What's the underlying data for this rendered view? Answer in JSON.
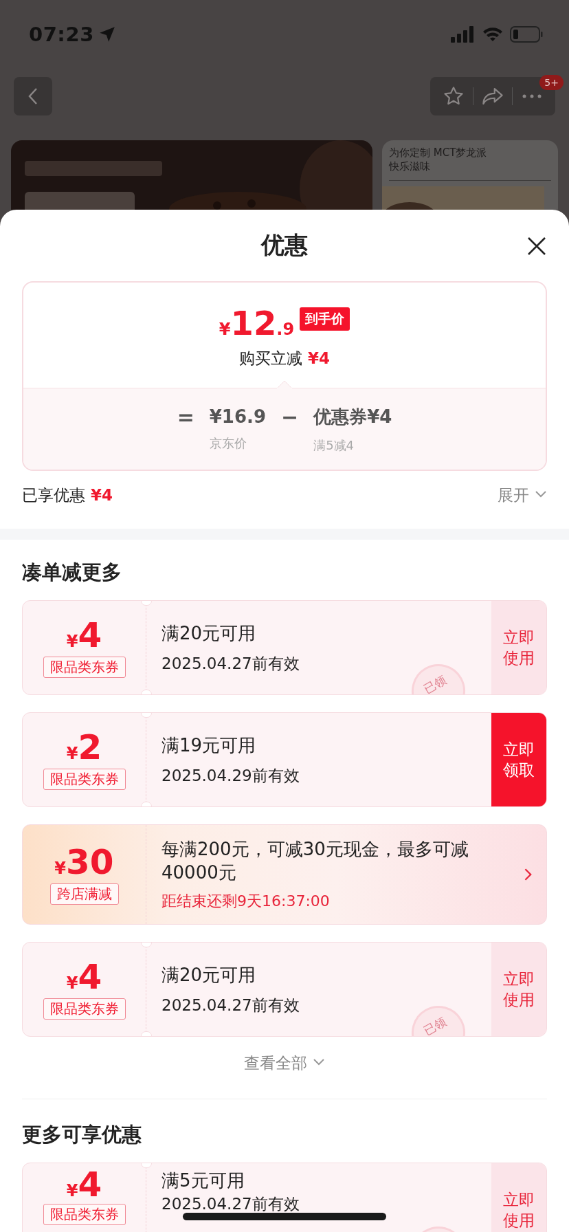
{
  "status_bar": {
    "time": "07:23"
  },
  "nav": {
    "badge": "5+"
  },
  "background": {
    "side_card_lines": [
      "为你定制 MCT梦龙派",
      "快乐滋味"
    ]
  },
  "sheet": {
    "title": "优惠"
  },
  "price_card": {
    "currency": "¥",
    "integer": "12",
    "decimal": ".9",
    "badge": "到手价",
    "instant_label": "购买立减",
    "instant_amount": "¥4",
    "equals": "=",
    "minus": "−",
    "items": [
      {
        "value": "¥16.9",
        "caption": "京东价"
      },
      {
        "value": "优惠券¥4",
        "caption": "满5减4"
      }
    ]
  },
  "enjoyed": {
    "label": "已享优惠",
    "amount": "¥4",
    "toggle": "展开",
    "expanded": false
  },
  "sections": [
    {
      "title": "凑单减更多",
      "more": "查看全部",
      "coupons": [
        {
          "kind": "coupon",
          "currency": "¥",
          "amount": "4",
          "tag": "限品类东券",
          "condition": "满20元可用",
          "validity": "2025.04.27前有效",
          "action": "立即使用",
          "claimed": true,
          "stamp": "已领"
        },
        {
          "kind": "coupon",
          "currency": "¥",
          "amount": "2",
          "tag": "限品类东券",
          "condition": "满19元可用",
          "validity": "2025.04.29前有效",
          "action": "立即领取",
          "claimed": false
        },
        {
          "kind": "promo",
          "currency": "¥",
          "amount": "30",
          "tag": "跨店满减",
          "condition": "每满200元，可减30元现金，最多可减40000元",
          "countdown": "距结束还剩9天16:37:00"
        },
        {
          "kind": "coupon",
          "currency": "¥",
          "amount": "4",
          "tag": "限品类东券",
          "condition": "满20元可用",
          "validity": "2025.04.27前有效",
          "action": "立即使用",
          "claimed": true,
          "stamp": "已领"
        }
      ]
    },
    {
      "title": "更多可享优惠",
      "coupons": [
        {
          "kind": "coupon",
          "currency": "¥",
          "amount": "4",
          "tag": "限品类东券",
          "condition": "满5元可用",
          "validity": "2025.04.27前有效",
          "action": "立即使用",
          "claimed": true
        }
      ]
    }
  ]
}
